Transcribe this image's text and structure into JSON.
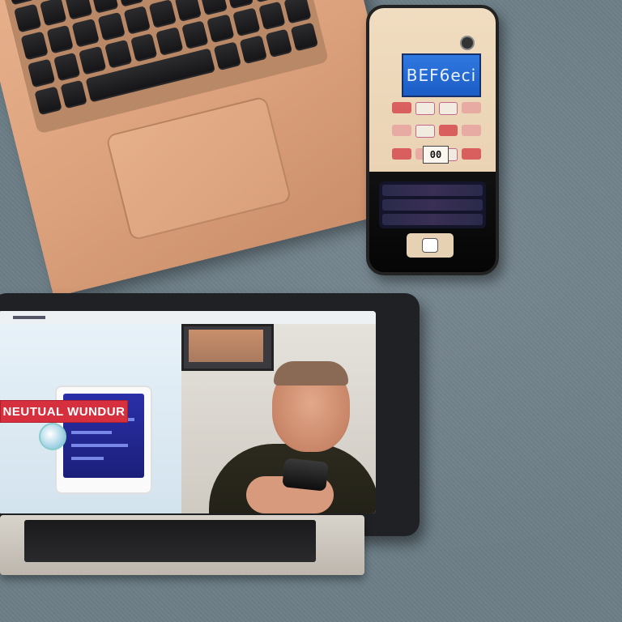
{
  "scene": {
    "objects": [
      "laptop",
      "phone",
      "tablet"
    ]
  },
  "phone": {
    "screen_text": "BEF6eci",
    "counter_text": "00"
  },
  "tablet": {
    "banner_text": "NEUTUAL WUNDUR"
  },
  "colors": {
    "desk": "#6d7e87",
    "laptop": "#dca27d",
    "phone_screen": "#2f79e0",
    "banner": "#d6303f"
  }
}
